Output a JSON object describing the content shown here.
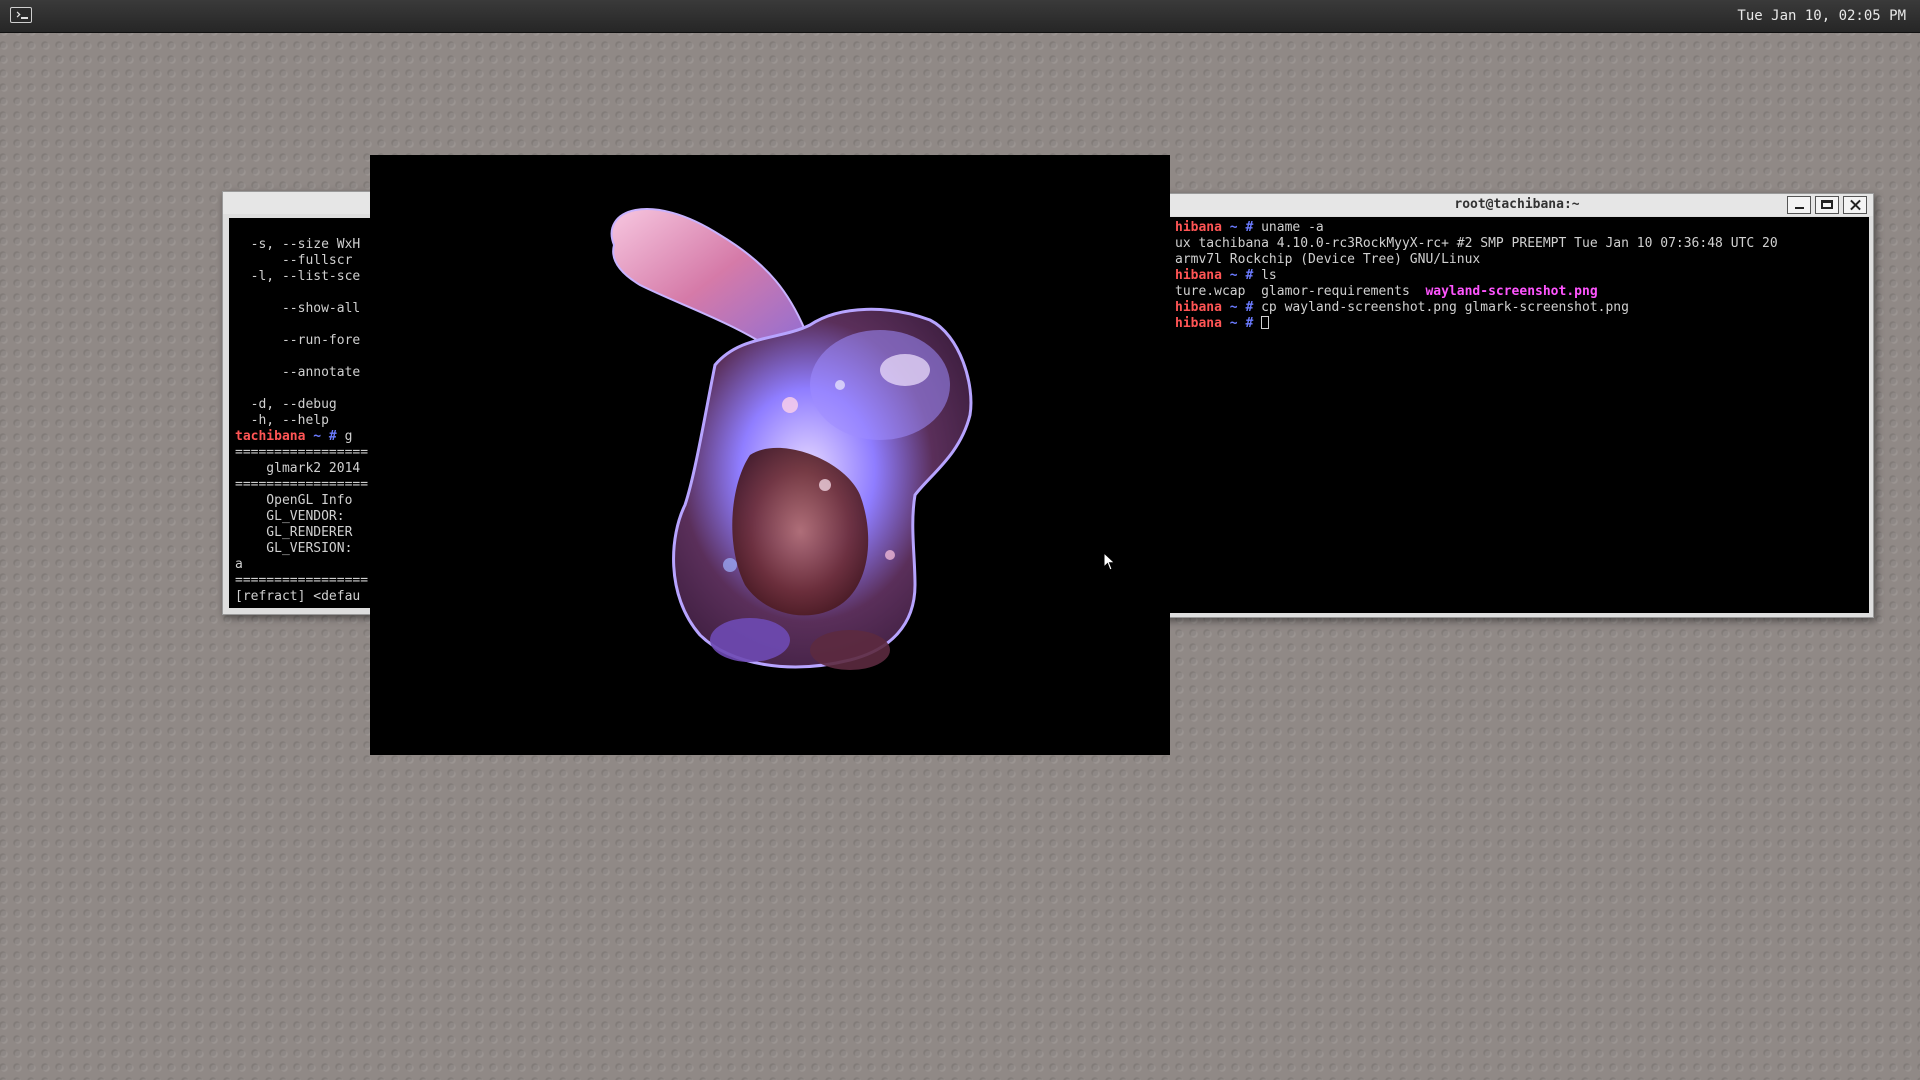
{
  "panel": {
    "launcher_icon": "terminal-icon",
    "clock": "Tue Jan 10, 02:05 PM"
  },
  "left_terminal": {
    "lines": [
      "",
      "  -s, --size WxH",
      "      --fullscr",
      "  -l, --list-sce",
      "",
      "      --show-all",
      "",
      "      --run-fore",
      "",
      "      --annotate",
      "",
      "  -d, --debug",
      "  -h, --help"
    ],
    "prompt": {
      "host": "tachibana",
      "sep": " ~ # ",
      "cmd": "g"
    },
    "lines_after": [
      "=================",
      "    glmark2 2014",
      "=================",
      "    OpenGL Info",
      "    GL_VENDOR:",
      "    GL_RENDERER",
      "    GL_VERSION:",
      "a",
      "=================",
      "[refract] <defau"
    ]
  },
  "right_terminal": {
    "title": "root@tachibana:~",
    "buttons": {
      "minimize": "minimize-icon",
      "maximize": "maximize-icon",
      "close": "close-icon"
    },
    "rows": [
      {
        "host": "hibana",
        "sep": " ~ # ",
        "cmd": "uname -a"
      },
      {
        "text": "ux tachibana 4.10.0-rc3RockMyyX-rc+ #2 SMP PREEMPT Tue Jan 10 07:36:48 UTC 20"
      },
      {
        "text": "armv7l Rockchip (Device Tree) GNU/Linux"
      },
      {
        "host": "hibana",
        "sep": " ~ # ",
        "cmd": "ls"
      },
      {
        "text": "ture.wcap  glamor-requirements  ",
        "highlight": "wayland-screenshot.png"
      },
      {
        "host": "hibana",
        "sep": " ~ # ",
        "cmd": "cp wayland-screenshot.png glmark-screenshot.png"
      },
      {
        "host": "hibana",
        "sep": " ~ # ",
        "cmd": "",
        "cursor": true
      }
    ]
  },
  "glmark": {
    "scene_icon": "glass-bunny-render",
    "colors": {
      "background": "#000000",
      "glass": "#8a7cff",
      "tint": "#ff9ad1"
    }
  },
  "colors": {
    "prompt_host": "#ff5555",
    "prompt_sep": "#6b7bff",
    "highlight": "#ff55ff",
    "desktop": "#908986",
    "panel": "#2e2e2e"
  }
}
